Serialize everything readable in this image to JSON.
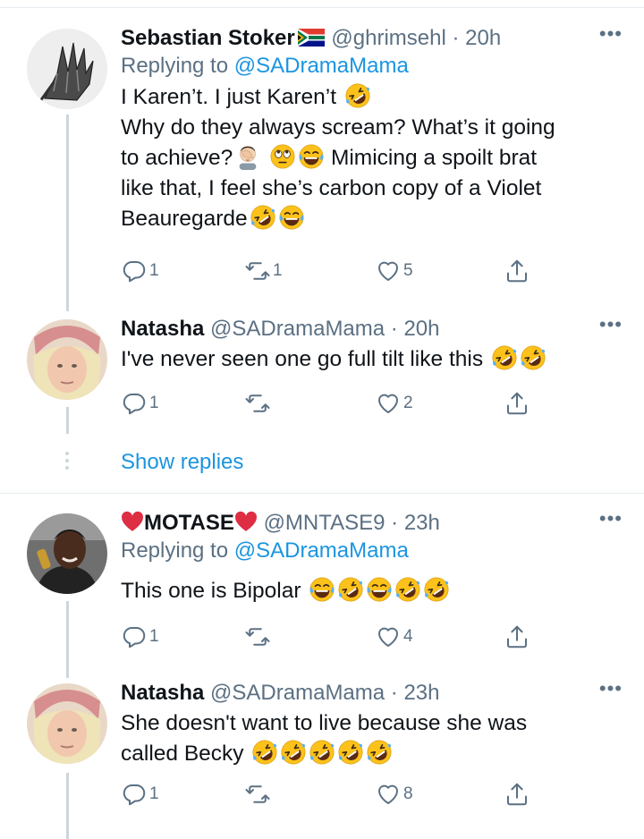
{
  "tweets": [
    {
      "name": "Sebastian Stoker",
      "handle": "@ghrimsehl",
      "time": "· 20h",
      "replying_prefix": "Replying to ",
      "replying_to": "@SADramaMama",
      "lines": [
        "I Karen’t. I just Karen’t",
        "Why do they always scream? What’s it going",
        "to achieve?",
        "Mimicing a spoilt brat",
        "like that, I feel she’s carbon copy of a Violet",
        "Beauregarde"
      ],
      "replies": "1",
      "retweets": "1",
      "likes": "5"
    },
    {
      "name": "Natasha",
      "handle": "@SADramaMama",
      "time": "· 20h",
      "text": "I've never seen one go full tilt like this",
      "replies": "1",
      "retweets": "",
      "likes": "2"
    },
    {
      "name": "MOTASE",
      "handle": "@MNTASE9",
      "time": "· 23h",
      "replying_prefix": "Replying to ",
      "replying_to": "@SADramaMama",
      "text": "This one is Bipolar",
      "replies": "1",
      "retweets": "",
      "likes": "4"
    },
    {
      "name": "Natasha",
      "handle": "@SADramaMama",
      "time": "· 23h",
      "lines": [
        "She doesn't want to live because she was",
        "called Becky"
      ],
      "replies": "1",
      "retweets": "",
      "likes": "8"
    }
  ],
  "show_replies": "Show replies",
  "more_glyph": "•••",
  "icons": {
    "reply": "reply-icon",
    "retweet": "retweet-icon",
    "like": "like-icon",
    "share": "share-icon",
    "rofl": "rolling-on-floor-laughing-emoji",
    "tears": "face-with-tears-of-joy-emoji",
    "facepalm": "man-facepalming-emoji",
    "eyeroll": "face-with-rolling-eyes-emoji",
    "heart": "red-heart-emoji",
    "flag": "south-africa-flag-emoji"
  },
  "colors": {
    "link": "#1b95e0",
    "muted": "#5b7083",
    "divider": "#e6ecf0",
    "thread": "#ccd6dd"
  }
}
